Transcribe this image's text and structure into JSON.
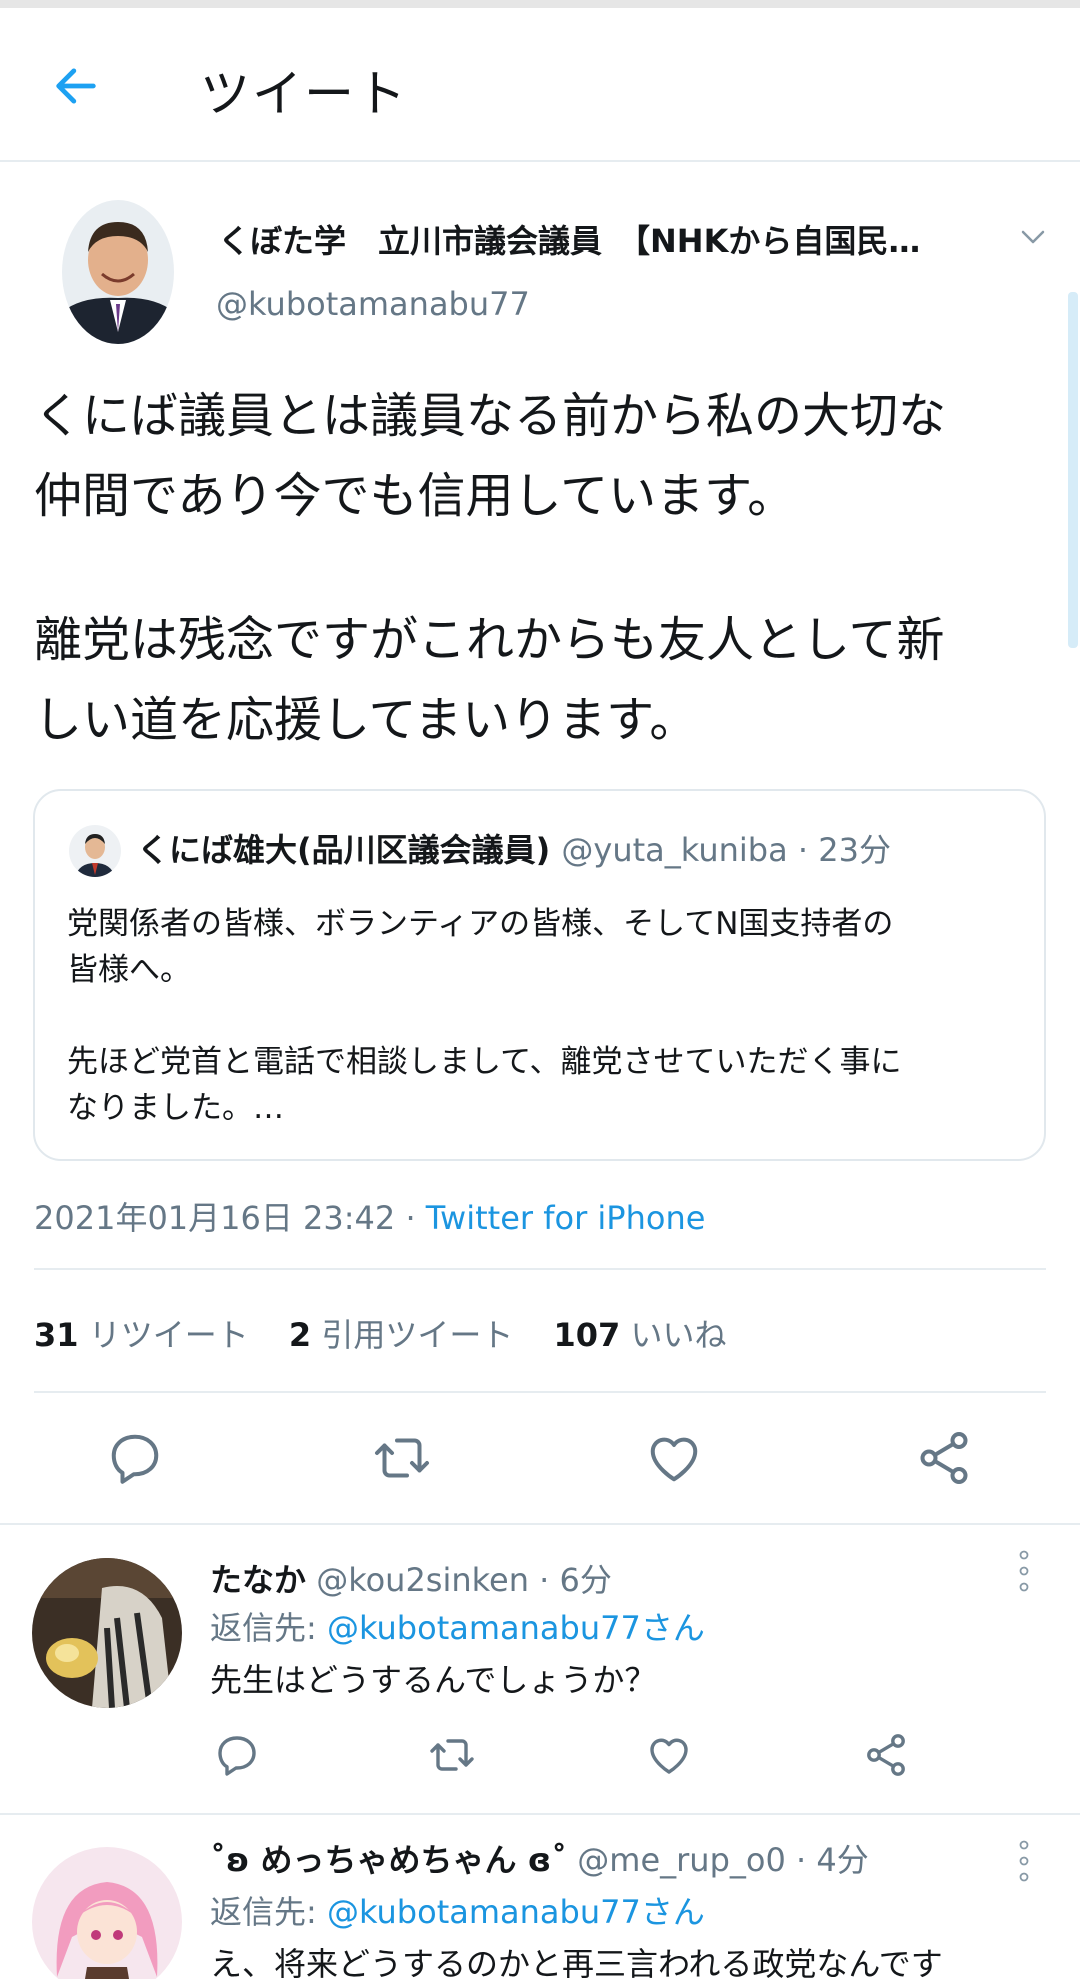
{
  "header": {
    "title": "ツイート"
  },
  "tweet": {
    "author_name": "くぼた学　立川市議会議員　【NHKから自国民…",
    "author_handle": "@kubotamanabu77",
    "text_lines": [
      "くにば議員とは議員なる前から私の大切な",
      "仲間であり今でも信用しています。",
      "離党は残念ですがこれからも友人として新",
      "しい道を応援してまいります。"
    ],
    "quote": {
      "name": "くにば雄大(品川区議会議員)",
      "handle_time": "@yuta_kuniba · 23分",
      "lines": [
        "党関係者の皆様、ボランティアの皆様、そしてN国支持者の",
        "皆様へ。",
        "先ほど党首と電話で相談しまして、離党させていただく事に",
        "なりました。…"
      ]
    },
    "timestamp": "2021年01月16日 23:42 · ",
    "source": "Twitter for iPhone",
    "stats": {
      "retweets_count": "31",
      "retweets_label": "リツイート",
      "quotes_count": "2",
      "quotes_label": "引用ツイート",
      "likes_count": "107",
      "likes_label": "いいね"
    }
  },
  "replies": [
    {
      "name": "たなか",
      "handle_time": "@kou2sinken · 6分",
      "reply_to_prefix": "返信先: ",
      "reply_to_mention": "@kubotamanabu77さん",
      "text": "先生はどうするんでしょうか？"
    },
    {
      "name": "˚ʚ めっちゃめちゃん ɞ˚",
      "handle_time": "@me_rup_o0 · 4分",
      "reply_to_prefix": "返信先: ",
      "reply_to_mention": "@kubotamanabu77さん",
      "text": "え、将来どうするのかと再三言われる政党なんです"
    }
  ],
  "colors": {
    "accent": "#1b95e0",
    "secondary_text": "#657786",
    "divider": "#e6ecf0"
  },
  "icons": [
    "back-arrow-icon",
    "chevron-down-icon",
    "reply-icon",
    "retweet-icon",
    "like-icon",
    "share-icon",
    "more-vertical-icon"
  ]
}
